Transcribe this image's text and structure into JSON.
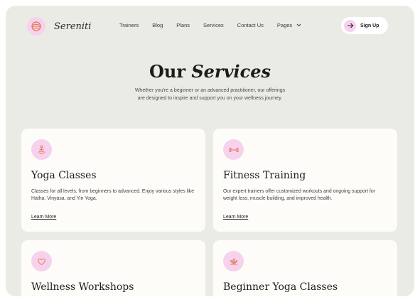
{
  "brand": {
    "name": "Sereniti"
  },
  "nav": {
    "items": [
      {
        "label": "Trainers"
      },
      {
        "label": "Blog"
      },
      {
        "label": "Plans"
      },
      {
        "label": "Services"
      },
      {
        "label": "Contact Us"
      },
      {
        "label": "Pages"
      }
    ]
  },
  "signup": {
    "label": "Sign Up"
  },
  "hero": {
    "title_plain": "Our",
    "title_italic": "Services",
    "subtitle": "Whether you're a beginner or an advanced practitioner, our offerings are designed to inspire and support you on your wellness journey."
  },
  "services": [
    {
      "icon": "meditation-icon",
      "title": "Yoga Classes",
      "description": "Classes for all levels, from beginners to advanced. Enjoy various styles like Hatha, Vinyasa, and Yin Yoga.",
      "link": "Learn More"
    },
    {
      "icon": "dumbbell-icon",
      "title": "Fitness Training",
      "description": "Our expert trainers offer customized workouts and ongoing support for weight loss, muscle building, and improved health.",
      "link": "Learn More"
    },
    {
      "icon": "heart-hand-icon",
      "title": "Wellness Workshops",
      "description": "",
      "link": ""
    },
    {
      "icon": "lotus-icon",
      "title": "Beginner Yoga Classes",
      "description": "",
      "link": ""
    }
  ],
  "colors": {
    "background": "#ebebe6",
    "card": "#fdfcf9",
    "icon_bg": "#f6d2ec",
    "accent": "#e0704c"
  }
}
